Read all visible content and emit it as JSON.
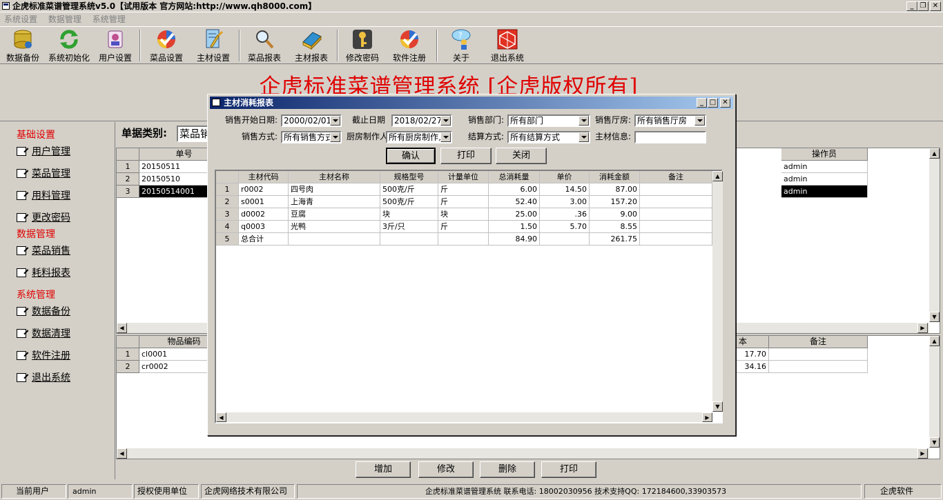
{
  "window": {
    "title": "企虎标准菜谱管理系统v5.0【试用版本 官方网站:http://www.qh8000.com】",
    "buttons": {
      "minimize": "_",
      "restore": "❐",
      "close": "✕"
    }
  },
  "menu": [
    "系统设置",
    "数据管理",
    "系统管理"
  ],
  "toolbar": [
    {
      "label": "数据备份",
      "icon": "database-backup-icon"
    },
    {
      "label": "系统初始化",
      "icon": "refresh-icon"
    },
    {
      "label": "用户设置",
      "icon": "user-settings-icon"
    },
    {
      "label": "菜品设置",
      "icon": "check-icon"
    },
    {
      "label": "主材设置",
      "icon": "edit-icon"
    },
    {
      "label": "菜品报表",
      "icon": "search-icon"
    },
    {
      "label": "主材报表",
      "icon": "book-icon"
    },
    {
      "label": "修改密码",
      "icon": "key-icon"
    },
    {
      "label": "软件注册",
      "icon": "register-icon"
    },
    {
      "label": "关于",
      "icon": "info-icon"
    },
    {
      "label": "退出系统",
      "icon": "exit-icon"
    }
  ],
  "banner": {
    "title": "企虎标准菜谱管理系统 [企虎版权所有]"
  },
  "nav": {
    "section1": "基础设置",
    "items1": [
      "用户管理",
      "菜品管理",
      "用料管理",
      "更改密码"
    ],
    "section2": "数据管理",
    "items2": [
      "菜品销售",
      "耗料报表"
    ],
    "section3": "系统管理",
    "items3": [
      "数据备份",
      "数据清理",
      "软件注册",
      "退出系统"
    ]
  },
  "main": {
    "bill_type_label": "单据类别:",
    "bill_type_value": "菜品销",
    "top_grid": {
      "col_no": "单号",
      "col_operator": "操作员",
      "rows": [
        {
          "n": "1",
          "no": "20150511",
          "operator": "admin"
        },
        {
          "n": "2",
          "no": "20150510",
          "operator": "admin"
        },
        {
          "n": "3",
          "no": "20150514001",
          "operator": "admin"
        }
      ]
    },
    "bottom_grid": {
      "col_code": "物品编码",
      "col_cost_partial": "本",
      "col_remark": "备注",
      "rows": [
        {
          "n": "1",
          "code": "cl0001",
          "cost": "17.70"
        },
        {
          "n": "2",
          "code": "cr0002",
          "cost": "34.16"
        }
      ]
    },
    "buttons": {
      "add": "增加",
      "edit": "修改",
      "delete": "删除",
      "print": "打印"
    }
  },
  "dialog": {
    "title": "主材消耗报表",
    "start_date_label": "销售开始日期:",
    "start_date": "2000/02/01",
    "end_date_label": "截止日期",
    "end_date": "2018/02/27",
    "dept_label": "销售部门:",
    "dept": "所有部门",
    "hall_label": "销售厅房:",
    "hall": "所有销售厅房",
    "method_label": "销售方式:",
    "method": "所有销售方式",
    "chef_label": "厨房制作人",
    "chef": "所有厨房制作人",
    "settle_label": "结算方式:",
    "settle": "所有结算方式",
    "info_label": "主材信息:",
    "info": "",
    "buttons": {
      "confirm": "确认",
      "print": "打印",
      "close": "关闭"
    },
    "columns": [
      "主材代码",
      "主材名称",
      "规格型号",
      "计量单位",
      "总消耗量",
      "单价",
      "消耗金额",
      "备注"
    ],
    "rows": [
      {
        "n": "1",
        "code": "r0002",
        "name": "四号肉",
        "spec": "500克/斤",
        "unit": "斤",
        "qty": "6.00",
        "price": "14.50",
        "amount": "87.00",
        "remark": ""
      },
      {
        "n": "2",
        "code": "s0001",
        "name": "上海青",
        "spec": "500克/斤",
        "unit": "斤",
        "qty": "52.40",
        "price": "3.00",
        "amount": "157.20",
        "remark": ""
      },
      {
        "n": "3",
        "code": "d0002",
        "name": "豆腐",
        "spec": "块",
        "unit": "块",
        "qty": "25.00",
        "price": ".36",
        "amount": "9.00",
        "remark": ""
      },
      {
        "n": "4",
        "code": "q0003",
        "name": "光鸭",
        "spec": "3斤/只",
        "unit": "斤",
        "qty": "1.50",
        "price": "5.70",
        "amount": "8.55",
        "remark": ""
      },
      {
        "n": "5",
        "code": "总合计",
        "name": "",
        "spec": "",
        "unit": "",
        "qty": "84.90",
        "price": "",
        "amount": "261.75",
        "remark": ""
      }
    ]
  },
  "statusbar": {
    "user_label": "当前用户",
    "user": "admin",
    "licensed_label": "授权使用单位",
    "licensed": "企虎网络技术有限公司",
    "info": "企虎标准菜谱管理系统   联系电话: 18002030956   技术支持QQ: 172184600,33903573",
    "brand": "企虎软件"
  }
}
